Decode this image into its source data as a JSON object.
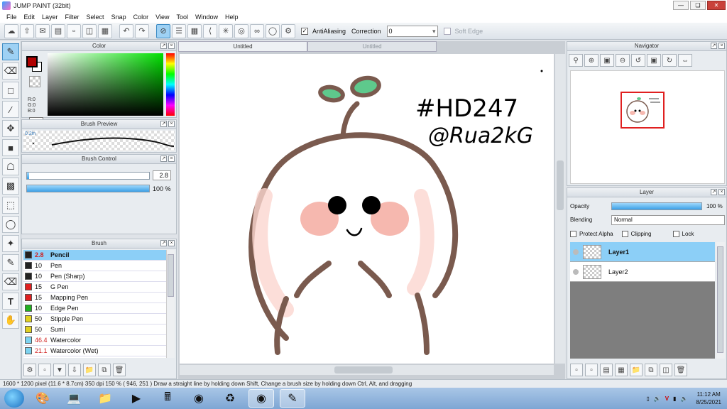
{
  "window": {
    "title": "JUMP PAINT (32bit)"
  },
  "menu": [
    "File",
    "Edit",
    "Layer",
    "Filter",
    "Select",
    "Snap",
    "Color",
    "View",
    "Tool",
    "Window",
    "Help"
  ],
  "toolbar": {
    "antialiasing_label": "AntiAliasing",
    "correction_label": "Correction",
    "correction_value": "0",
    "soft_edge_label": "Soft Edge"
  },
  "color_panel": {
    "title": "Color",
    "rgb_r": "R:0",
    "rgb_g": "G:0",
    "rgb_b": "B:0",
    "fg_color": "#b00000"
  },
  "brush_preview": {
    "title": "Brush Preview",
    "size": "0.2in"
  },
  "brush_control": {
    "title": "Brush Control",
    "size_value": "2.8",
    "opacity_value": "100 %",
    "opacity": 1.0,
    "size_fraction": 0.02
  },
  "brush_panel": {
    "title": "Brush",
    "items": [
      {
        "size": "2.8",
        "name": "Pencil",
        "color": "#222222",
        "selected": true,
        "size_red": true
      },
      {
        "size": "10",
        "name": "Pen",
        "color": "#222222"
      },
      {
        "size": "10",
        "name": "Pen (Sharp)",
        "color": "#222222"
      },
      {
        "size": "15",
        "name": "G Pen",
        "color": "#e02020"
      },
      {
        "size": "15",
        "name": "Mapping Pen",
        "color": "#e02020"
      },
      {
        "size": "10",
        "name": "Edge Pen",
        "color": "#20b020"
      },
      {
        "size": "50",
        "name": "Stipple Pen",
        "color": "#e0d020"
      },
      {
        "size": "50",
        "name": "Sumi",
        "color": "#e0d020"
      },
      {
        "size": "46.4",
        "name": "Watercolor",
        "color": "#7dd3f0",
        "size_red": true
      },
      {
        "size": "21.1",
        "name": "Watercolor (Wet)",
        "color": "#7dd3f0",
        "size_red": true
      }
    ]
  },
  "tabs": [
    "Untitled",
    "Untitled"
  ],
  "artwork": {
    "text_line1": "#HD247",
    "text_line2": "@Rua2kG"
  },
  "navigator": {
    "title": "Navigator"
  },
  "layer_panel": {
    "title": "Layer",
    "opacity_label": "Opacity",
    "opacity_value": "100 %",
    "blending_label": "Blending",
    "blending_value": "Normal",
    "protect_alpha": "Protect Alpha",
    "clipping": "Clipping",
    "lock": "Lock",
    "layers": [
      {
        "name": "Layer1",
        "selected": true
      },
      {
        "name": "Layer2",
        "selected": false
      }
    ]
  },
  "status": {
    "text": "1600 * 1200 pixel  (11.6 * 8.7cm)  350 dpi  150 %  ( 946, 251 )  Draw a straight line by holding down Shift, Change a brush size by holding down Ctrl, Alt, and dragging"
  },
  "taskbar": {
    "time": "11:12 AM",
    "date": "8/25/2021"
  },
  "colors": {
    "accent": "#8ccff7",
    "highlight": "#3ca0e6"
  }
}
